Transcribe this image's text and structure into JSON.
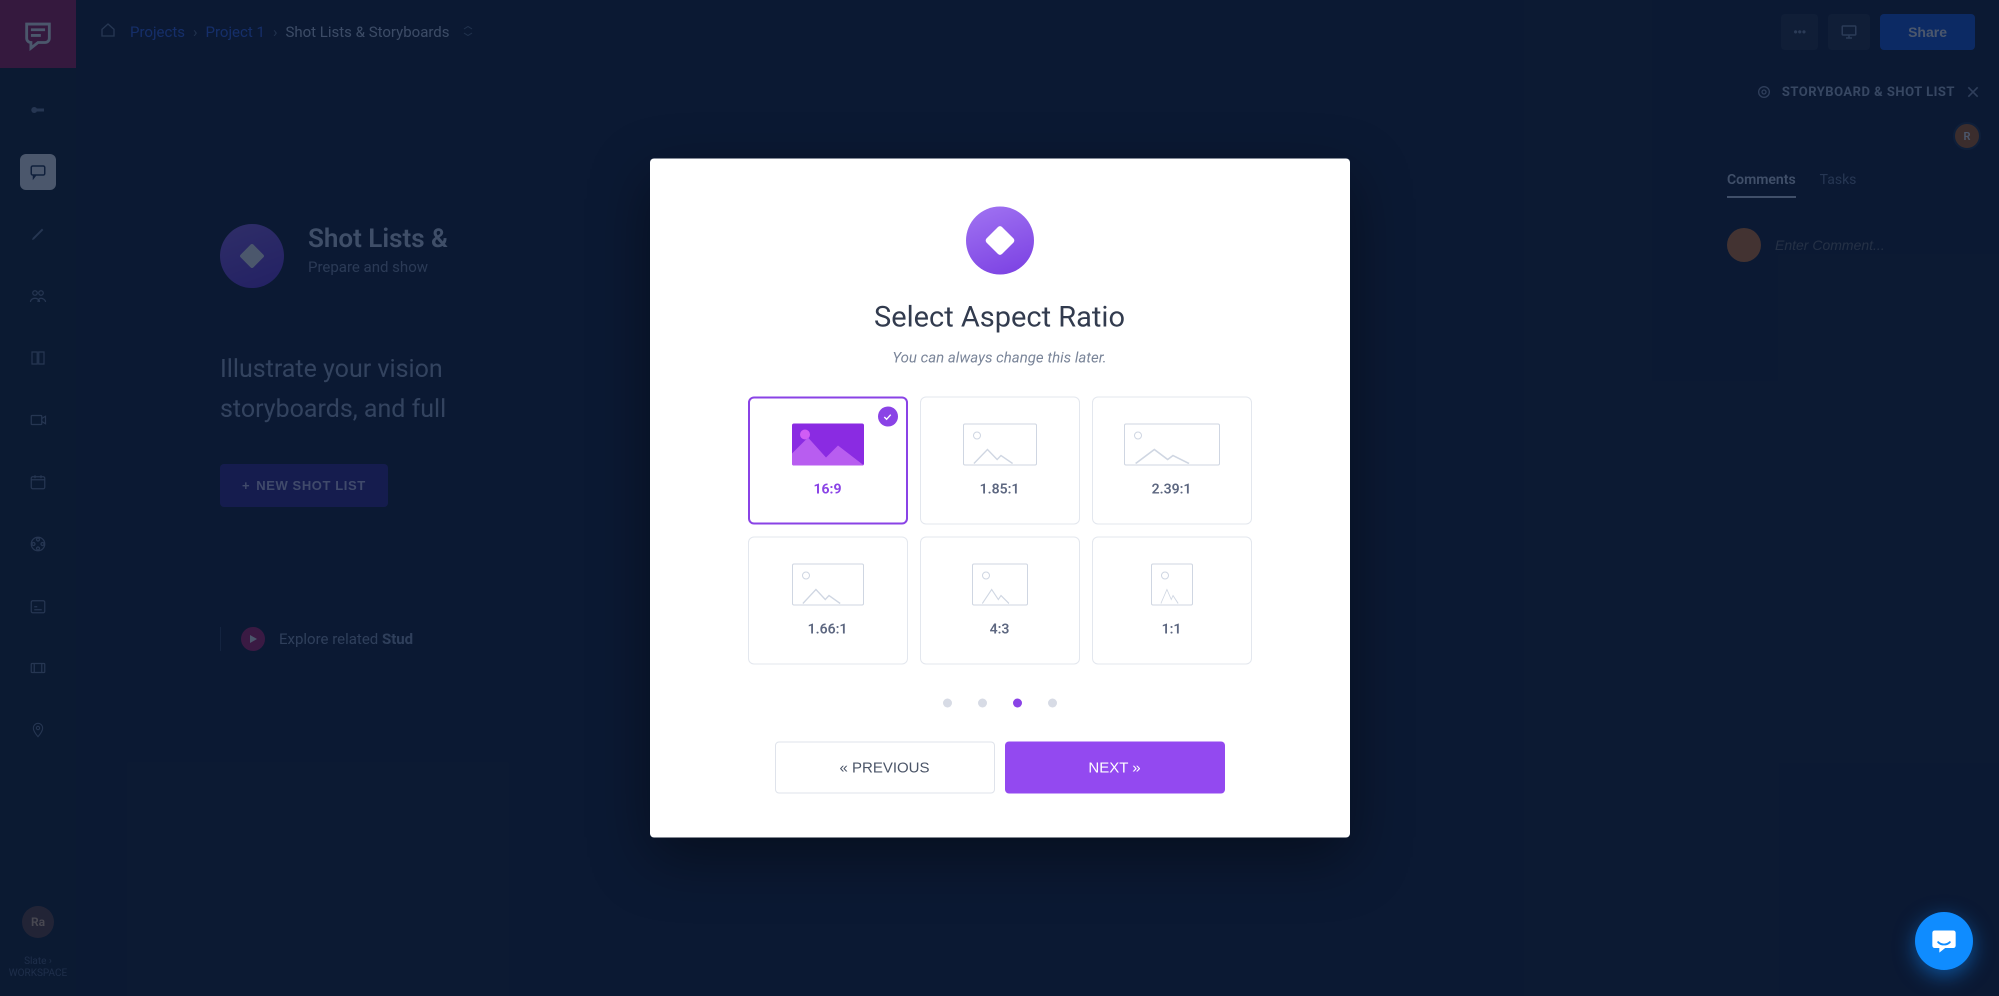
{
  "rail": {
    "avatar_initials": "Ra",
    "footer_line1": "Slate ›",
    "footer_line2": "WORKSPACE"
  },
  "breadcrumb": {
    "root": "Projects",
    "project": "Project 1",
    "current": "Shot Lists & Storyboards"
  },
  "topbar": {
    "menu_label": "•••",
    "share_label": "Share"
  },
  "hero": {
    "title": "Shot Lists &",
    "subtitle": "Prepare and show",
    "illustrate_l1": "Illustrate your vision",
    "illustrate_l2": "storyboards, and full",
    "new_button": "NEW SHOT LIST",
    "explore_prefix": "Explore related ",
    "explore_bold": "Stud"
  },
  "right_panel": {
    "title": "STORYBOARD & SHOT LIST",
    "avatar_initials": "R",
    "tab_comments": "Comments",
    "tab_tasks": "Tasks",
    "comment_placeholder": "Enter Comment..."
  },
  "modal": {
    "title": "Select Aspect Ratio",
    "subtitle": "You can always change this later.",
    "options": [
      {
        "label": "16:9",
        "selected": true
      },
      {
        "label": "1.85:1",
        "selected": false
      },
      {
        "label": "2.39:1",
        "selected": false
      },
      {
        "label": "1.66:1",
        "selected": false
      },
      {
        "label": "4:3",
        "selected": false
      },
      {
        "label": "1:1",
        "selected": false
      }
    ],
    "active_step": 2,
    "total_steps": 4,
    "prev_label": "« PREVIOUS",
    "next_label": "NEXT »"
  }
}
